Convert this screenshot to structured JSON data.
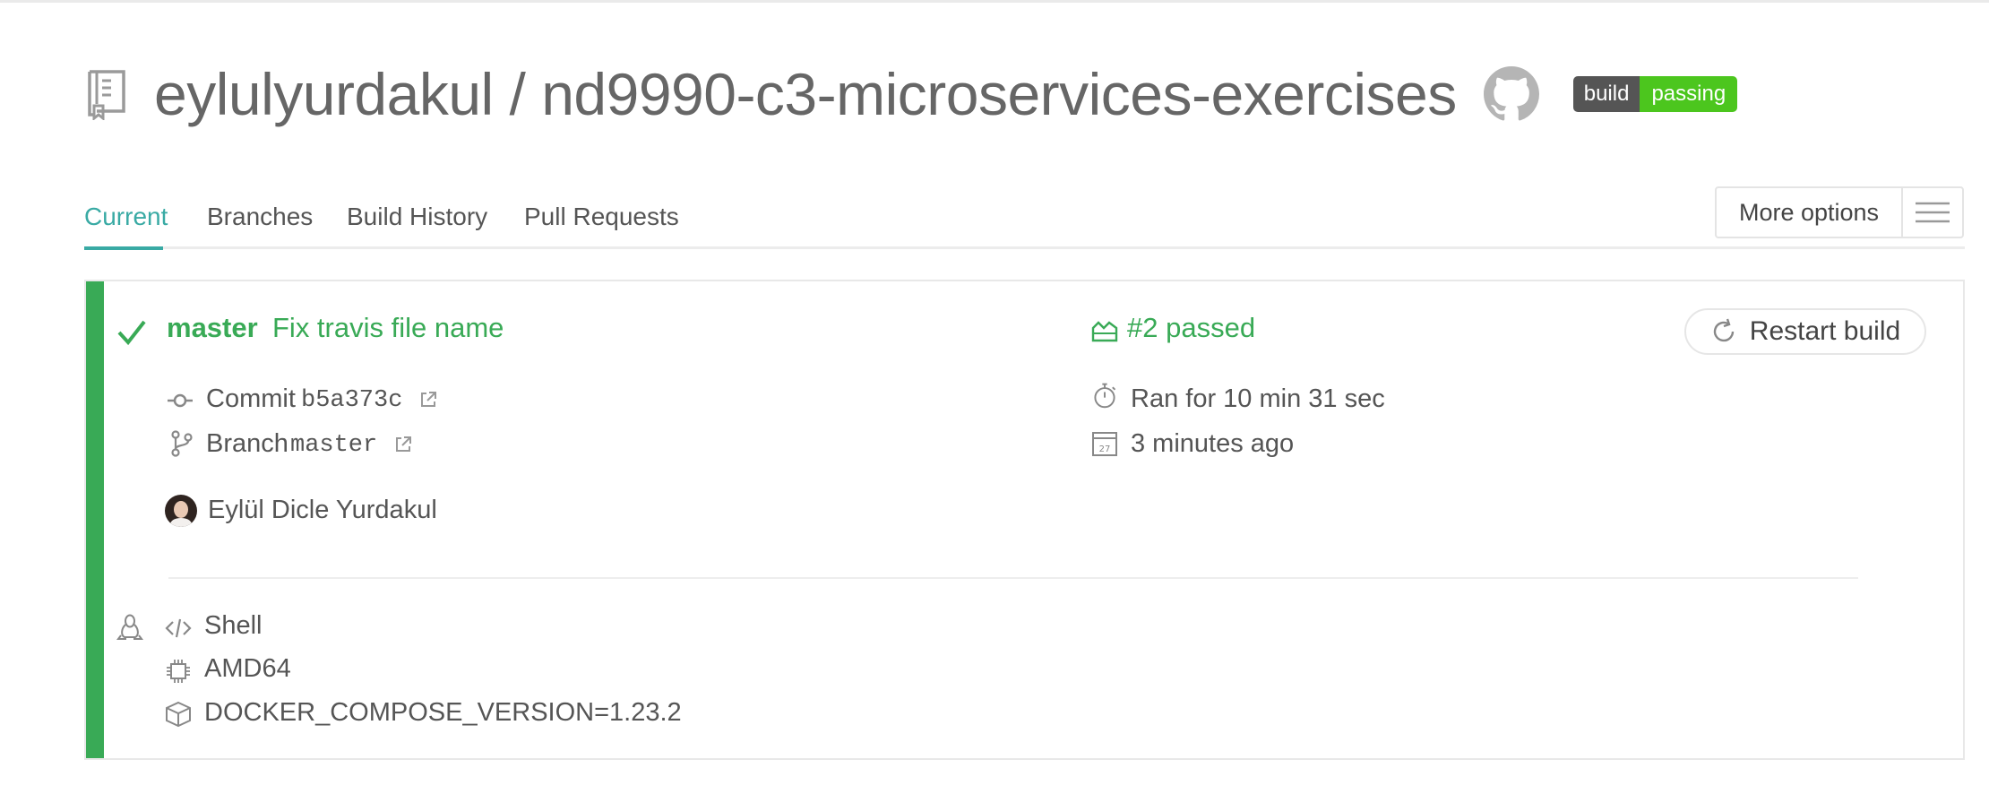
{
  "repo": {
    "title": "eylulyurdakul / nd9990-c3-microservices-exercises",
    "badge": {
      "left": "build",
      "right": "passing",
      "left_color": "#555555",
      "right_color": "#4cc61e"
    },
    "icons": {
      "repo": "repo-book-icon",
      "github": "github-icon"
    }
  },
  "tabs": [
    {
      "label": "Current",
      "active": true
    },
    {
      "label": "Branches",
      "active": false
    },
    {
      "label": "Build History",
      "active": false
    },
    {
      "label": "Pull Requests",
      "active": false
    }
  ],
  "more_options": {
    "label": "More options",
    "icon": "hamburger-icon"
  },
  "build": {
    "status_color": "#39aa56",
    "branch": "master",
    "commit_message": "Fix travis file name",
    "commit": {
      "label": "Commit",
      "sha": "b5a373c"
    },
    "branch_row": {
      "label": "Branch",
      "value": "master"
    },
    "author": "Eylül Dicle Yurdakul",
    "status": "#2 passed",
    "duration": "Ran for 10 min 31 sec",
    "finished": "3 minutes ago",
    "calendar_day": "27",
    "restart_label": "Restart build",
    "language": "Shell",
    "arch": "AMD64",
    "env": "DOCKER_COMPOSE_VERSION=1.23.2"
  },
  "colors": {
    "accent": "#39aaa4",
    "passed": "#39aa56",
    "text": "#555555"
  }
}
